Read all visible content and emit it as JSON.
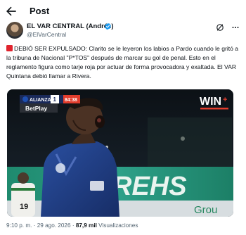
{
  "header": {
    "title": "Post"
  },
  "author": {
    "name": "EL VAR CENTRAL (Andrés)",
    "handle": "@ElVarCentral"
  },
  "tweet": {
    "text_bold": "DEBIÓ SER EXPULSADO:",
    "text_body": " Clarito se le leyeron los labios a Pardo cuando le gritó a la tribuna de Nacional \"P*TOS\" después de marcar su gol de penal. Esto en el reglamento figura como tarje roja por actuar de forma provocadora y exaltada. El VAR Quintana debió llamar a Rivera."
  },
  "media": {
    "scoreboard_team": "ALIANZA",
    "scoreboard_number": "1",
    "scoreboard_time": "84:38",
    "sponsor": "BetPlay",
    "broadcaster": "WIN",
    "broadcaster_plus": "+",
    "ad_board_text": "REHS",
    "ad_board_sub": "Grou",
    "jersey_number": "19"
  },
  "meta": {
    "time": "9:10 p. m.",
    "separator": "·",
    "date": "29 ago. 2026",
    "views_count": "87,9 mil",
    "views_label": "Visualizaciones"
  },
  "colors": {
    "accent_blue": "#1d9bf0",
    "red_square": "#e0242e",
    "text_muted": "#536471",
    "jersey_blue": "#1f3a7a"
  }
}
